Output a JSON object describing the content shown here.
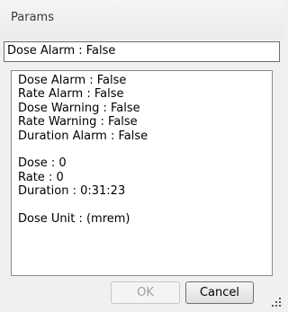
{
  "window": {
    "title": "Params"
  },
  "summary": {
    "value": "Dose Alarm : False"
  },
  "readout": {
    "alarms": [
      "Dose Alarm : False",
      "Rate Alarm : False",
      "Dose Warning : False",
      "Rate Warning : False",
      "Duration Alarm : False"
    ],
    "values": [
      "Dose : 0",
      "Rate : 0",
      "Duration : 0:31:23"
    ],
    "units": [
      "Dose Unit : (mrem)"
    ]
  },
  "buttons": {
    "ok_label": "OK",
    "cancel_label": "Cancel",
    "ok_enabled": false
  },
  "icons": {
    "resize_grip": "resize-grip-icon"
  }
}
